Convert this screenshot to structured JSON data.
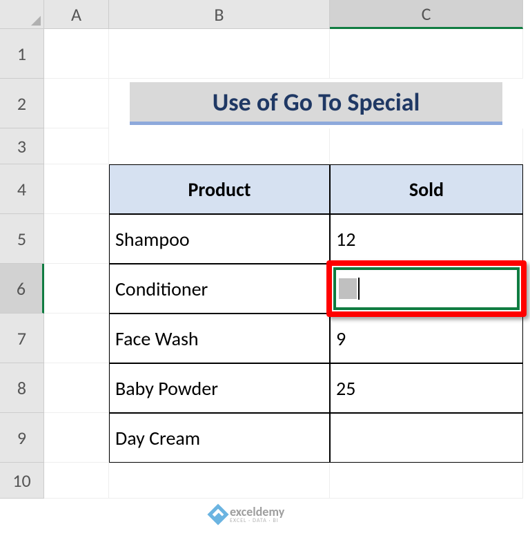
{
  "columns": [
    "A",
    "B",
    "C"
  ],
  "rows": [
    "1",
    "2",
    "3",
    "4",
    "5",
    "6",
    "7",
    "8",
    "9",
    "10"
  ],
  "active_column": "C",
  "active_row": "6",
  "title": "Use of Go To Special",
  "table": {
    "headers": {
      "product": "Product",
      "sold": "Sold"
    },
    "rows": [
      {
        "product": "Shampoo",
        "sold": "12"
      },
      {
        "product": "Conditioner",
        "sold": ""
      },
      {
        "product": "Face Wash",
        "sold": "9"
      },
      {
        "product": "Baby Powder",
        "sold": "25"
      },
      {
        "product": "Day Cream",
        "sold": ""
      }
    ]
  },
  "watermark": {
    "brand": "exceldemy",
    "tagline": "EXCEL · DATA · BI"
  }
}
